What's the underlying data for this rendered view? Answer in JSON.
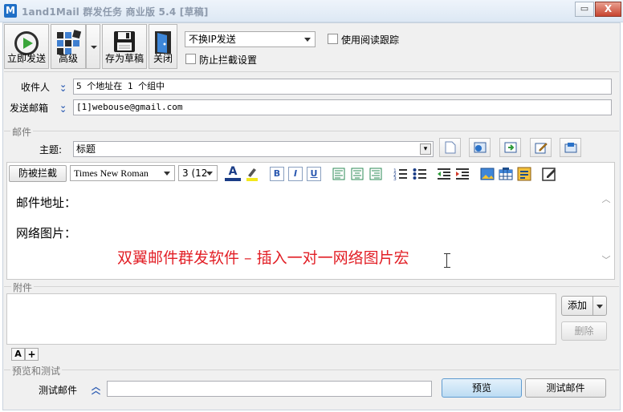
{
  "window": {
    "logo": "M",
    "title": "1and1Mail 群发任务 商业版 5.4 [草稿]",
    "min_glyph": "▭",
    "close_glyph": "X"
  },
  "toolbar": {
    "send_now": "立即发送",
    "advanced": "高级",
    "save_draft": "存为草稿",
    "close": "关闭",
    "ip_mode": "不换IP发送",
    "read_tracking": "使用阅读跟踪",
    "anti_block": "防止拦截设置"
  },
  "recipients": {
    "to_label": "收件人",
    "to_value": "5 个地址在 1 个组中",
    "from_label": "发送邮箱",
    "from_value": "[1]webouse@gmail.com"
  },
  "mail": {
    "section": "邮件",
    "subject_label": "主题:",
    "subject_value": "标题"
  },
  "format": {
    "anti_block": "防被拦截",
    "font": "Times New Roman",
    "size": "3 (12",
    "bold": "B",
    "italic": "I",
    "underline": "U"
  },
  "editor": {
    "line1": "邮件地址：",
    "line2": "网络图片：",
    "promo": "双翼邮件群发软件 – 插入一对一网络图片宏"
  },
  "attachments": {
    "section": "附件",
    "add": "添加",
    "delete": "删除",
    "font_a": "A",
    "font_plus": "+"
  },
  "preview": {
    "section": "预览和测试",
    "test_label": "测试邮件",
    "test_value": "",
    "preview_btn": "预览",
    "test_btn": "测试邮件"
  },
  "colors": {
    "promo": "#e21f26",
    "accent": "#2d5db3"
  }
}
